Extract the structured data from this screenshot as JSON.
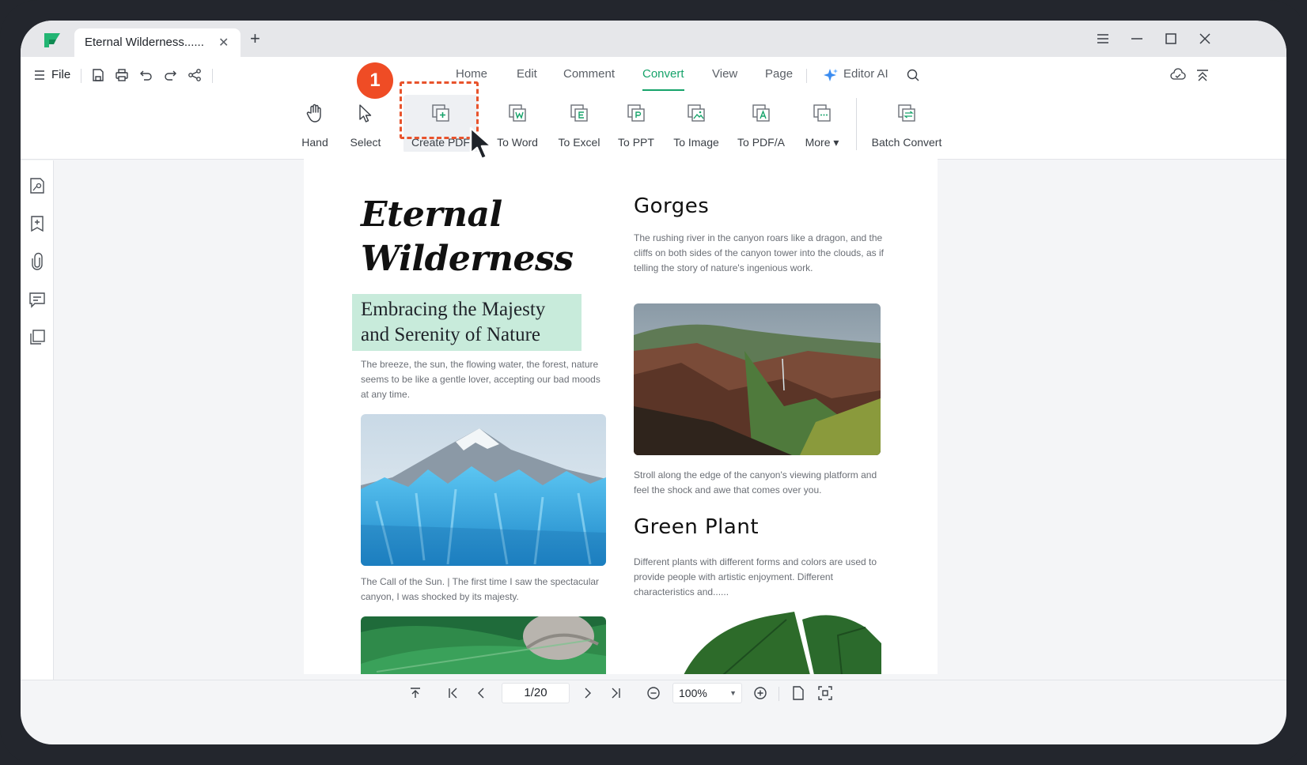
{
  "tab": {
    "title": "Eternal Wilderness......"
  },
  "menu": {
    "file_label": "File",
    "tabs": [
      {
        "label": "Home"
      },
      {
        "label": "Edit"
      },
      {
        "label": "Comment"
      },
      {
        "label": "Convert"
      },
      {
        "label": "View"
      },
      {
        "label": "Page"
      }
    ],
    "active_tab": "Convert",
    "editor_ai_label": "Editor AI"
  },
  "ribbon": {
    "tools": [
      {
        "label": "Hand"
      },
      {
        "label": "Select"
      },
      {
        "label": "Create PDF"
      },
      {
        "label": "To Word"
      },
      {
        "label": "To Excel"
      },
      {
        "label": "To PPT"
      },
      {
        "label": "To Image"
      },
      {
        "label": "To PDF/A"
      },
      {
        "label": "More ▾"
      },
      {
        "label": "Batch Convert"
      }
    ],
    "step_badge": "1"
  },
  "document": {
    "title_line1": "Eternal",
    "title_line2": "Wilderness",
    "subtitle_line1": "Embracing the Majesty",
    "subtitle_line2": "and Serenity of Nature",
    "intro_text": "The breeze, the sun, the flowing water, the forest, nature seems to be like a gentle lover, accepting our bad moods at any time.",
    "caption_1": "The Call of the Sun. | The first time I saw the spectacular canyon, I was shocked by its majesty.",
    "gorges_heading": "Gorges",
    "gorges_text": "The rushing river in the canyon roars like a dragon, and the cliffs on both sides of the canyon tower into the clouds, as if telling the story of nature's ingenious work.",
    "canyon_caption": "Stroll along the edge of the canyon's viewing platform and feel the shock and awe that comes over you.",
    "plant_heading": "Green Plant",
    "plant_text": "Different plants with different forms and colors are used to provide people with artistic enjoyment. Different characteristics and......"
  },
  "bottom": {
    "page_indicator": "1/20",
    "zoom": "100%"
  },
  "colors": {
    "accent": "#16a36a",
    "highlight": "#e8532c",
    "subtitle_bg": "#c8ebdb"
  }
}
